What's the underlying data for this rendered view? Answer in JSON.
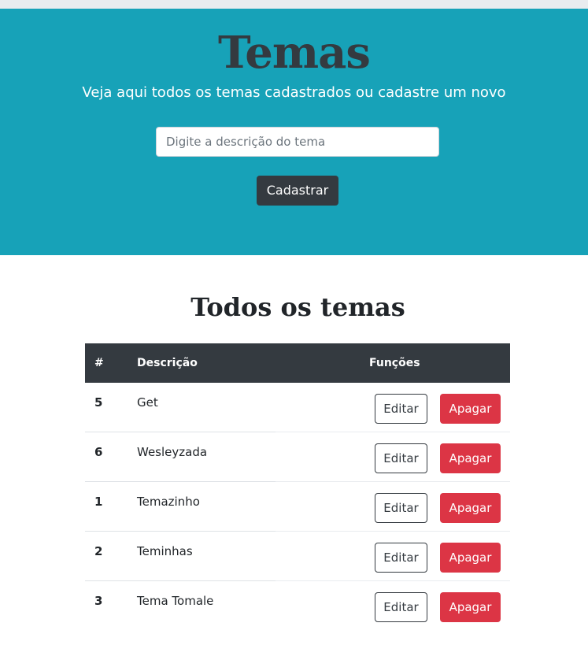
{
  "header": {
    "title": "Temas",
    "subtitle": "Veja aqui todos os temas cadastrados ou cadastre um novo",
    "input_placeholder": "Digite a descrição do tema",
    "input_value": "",
    "submit_label": "Cadastrar"
  },
  "list": {
    "title": "Todos os temas",
    "columns": {
      "id": "#",
      "description": "Descrição",
      "functions": "Funções"
    },
    "rows": [
      {
        "id": "5",
        "description": "Get",
        "edit_label": "Editar",
        "delete_label": "Apagar"
      },
      {
        "id": "6",
        "description": "Wesleyzada",
        "edit_label": "Editar",
        "delete_label": "Apagar"
      },
      {
        "id": "1",
        "description": "Temazinho",
        "edit_label": "Editar",
        "delete_label": "Apagar"
      },
      {
        "id": "2",
        "description": "Teminhas",
        "edit_label": "Editar",
        "delete_label": "Apagar"
      },
      {
        "id": "3",
        "description": "Tema Tomale",
        "edit_label": "Editar",
        "delete_label": "Apagar"
      }
    ]
  },
  "colors": {
    "hero_bg": "#17a2b8",
    "dark": "#343a40",
    "danger": "#dc3545",
    "white": "#ffffff"
  }
}
